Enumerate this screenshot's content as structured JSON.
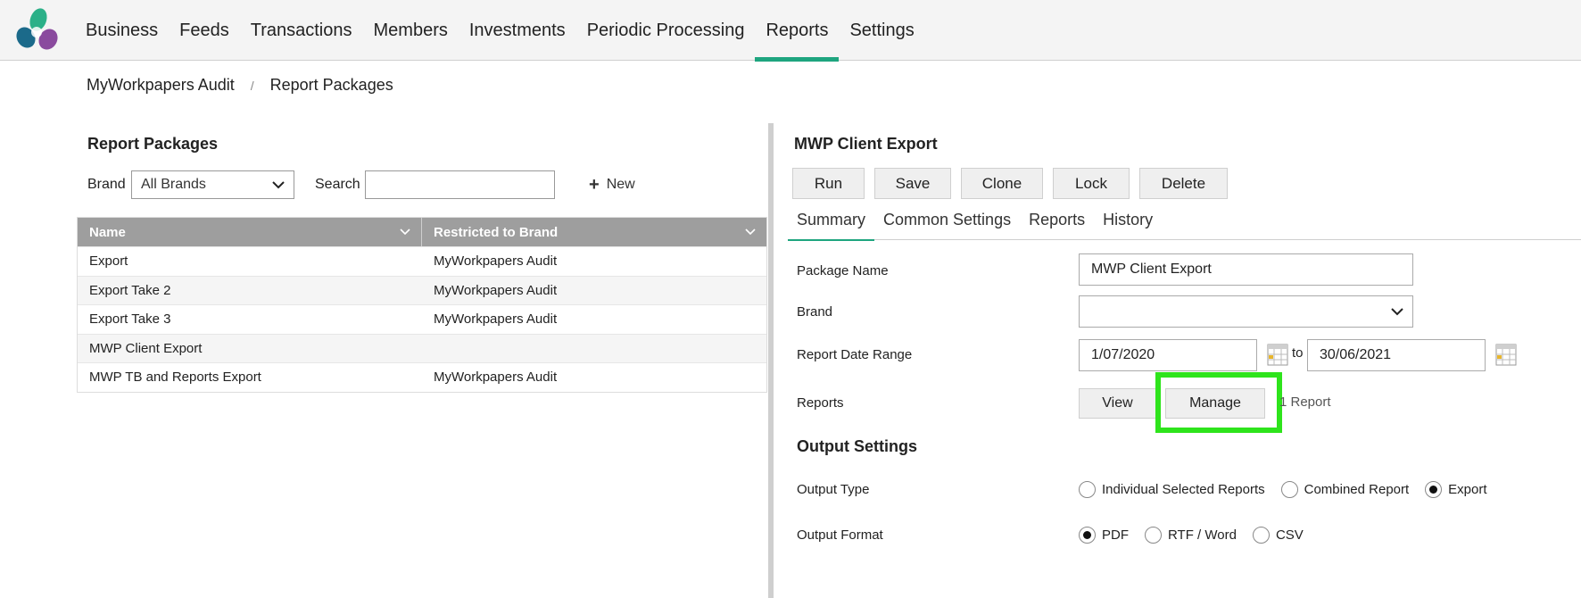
{
  "nav": {
    "items": [
      {
        "label": "Business",
        "active": false
      },
      {
        "label": "Feeds",
        "active": false
      },
      {
        "label": "Transactions",
        "active": false
      },
      {
        "label": "Members",
        "active": false
      },
      {
        "label": "Investments",
        "active": false
      },
      {
        "label": "Periodic Processing",
        "active": false
      },
      {
        "label": "Reports",
        "active": true
      },
      {
        "label": "Settings",
        "active": false
      }
    ],
    "accent_color": "#1ea57f"
  },
  "breadcrumb": {
    "root": "MyWorkpapers Audit",
    "separator": "/",
    "current": "Report Packages"
  },
  "left": {
    "title": "Report Packages",
    "brand_label": "Brand",
    "brand_value": "All Brands",
    "search_label": "Search",
    "search_value": "",
    "new_label": "New",
    "columns": [
      "Name",
      "Restricted to Brand"
    ],
    "rows": [
      {
        "name": "Export",
        "brand": "MyWorkpapers Audit"
      },
      {
        "name": "Export Take 2",
        "brand": "MyWorkpapers Audit"
      },
      {
        "name": "Export Take 3",
        "brand": "MyWorkpapers Audit"
      },
      {
        "name": "MWP Client Export",
        "brand": ""
      },
      {
        "name": "MWP TB and Reports Export",
        "brand": "MyWorkpapers Audit"
      }
    ]
  },
  "right": {
    "title": "MWP Client Export",
    "buttons": {
      "run": "Run",
      "save": "Save",
      "clone": "Clone",
      "lock": "Lock",
      "delete": "Delete"
    },
    "tabs": [
      {
        "label": "Summary",
        "active": true
      },
      {
        "label": "Common Settings",
        "active": false
      },
      {
        "label": "Reports",
        "active": false
      },
      {
        "label": "History",
        "active": false
      }
    ],
    "form": {
      "package_name_label": "Package Name",
      "package_name_value": "MWP Client Export",
      "brand_label": "Brand",
      "brand_value": "",
      "date_range_label": "Report Date Range",
      "date_from": "1/07/2020",
      "date_to_label": "to",
      "date_to": "30/06/2021",
      "reports_label": "Reports",
      "view_label": "View",
      "manage_label": "Manage",
      "report_count": "1 Report"
    },
    "output": {
      "section_title": "Output Settings",
      "type_label": "Output Type",
      "type_options": [
        {
          "label": "Individual Selected Reports",
          "selected": false
        },
        {
          "label": "Combined Report",
          "selected": false
        },
        {
          "label": "Export",
          "selected": true
        }
      ],
      "format_label": "Output Format",
      "format_options": [
        {
          "label": "PDF",
          "selected": true
        },
        {
          "label": "RTF / Word",
          "selected": false
        },
        {
          "label": "CSV",
          "selected": false
        }
      ]
    },
    "highlight_color": "#2ee41c"
  }
}
